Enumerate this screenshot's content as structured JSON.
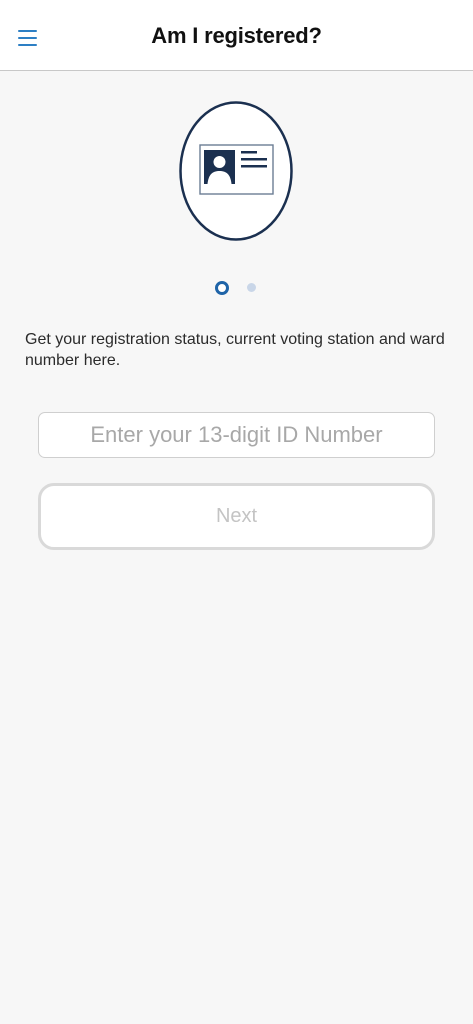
{
  "header": {
    "title": "Am I registered?",
    "menu_icon": "hamburger-menu-icon"
  },
  "illustration": {
    "icon": "id-card-icon",
    "colors": {
      "navy": "#1b3050",
      "card_border": "#6b7d94"
    }
  },
  "pager": {
    "total": 2,
    "active_index": 0,
    "colors": {
      "active": "#1f64a8",
      "inactive": "#c9d6e8"
    }
  },
  "main": {
    "description": "Get your registration status, current voting station and ward number here.",
    "id_input": {
      "value": "",
      "placeholder": "Enter your 13-digit ID Number"
    },
    "next_button": {
      "label": "Next",
      "enabled": false
    }
  },
  "colors": {
    "accent": "#2d7fc4",
    "background": "#f7f7f7",
    "disabled_text": "#c4c4c4"
  }
}
